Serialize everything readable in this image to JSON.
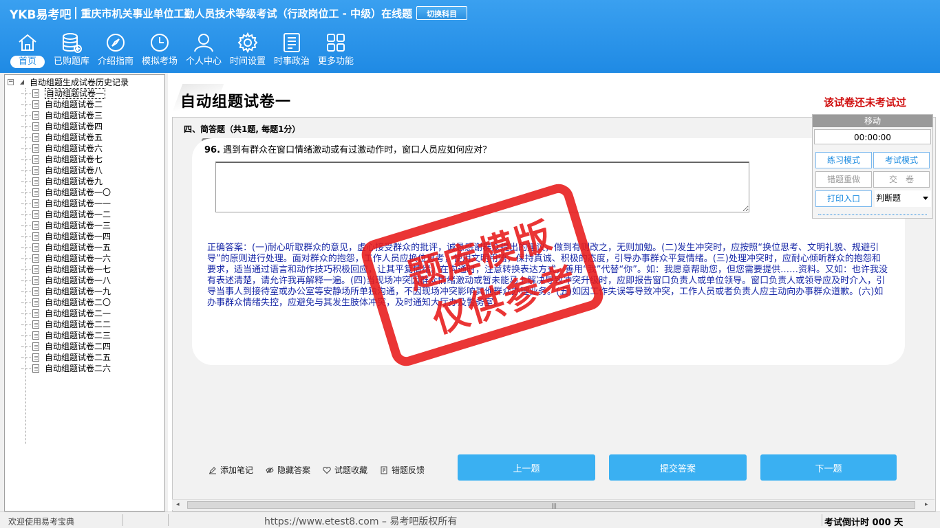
{
  "header": {
    "logo": "YKB易考吧",
    "app_title": "重庆市机关事业单位工勤人员技术等级考试（行政岗位工 - 中级）在线题",
    "switch_button": "切换科目",
    "nav": [
      {
        "label": "首页",
        "icon": "home-icon"
      },
      {
        "label": "已购题库",
        "icon": "database-icon"
      },
      {
        "label": "介绍指南",
        "icon": "compass-icon"
      },
      {
        "label": "模拟考场",
        "icon": "clock-icon"
      },
      {
        "label": "个人中心",
        "icon": "user-icon"
      },
      {
        "label": "时间设置",
        "icon": "gear-icon"
      },
      {
        "label": "时事政治",
        "icon": "news-icon"
      },
      {
        "label": "更多功能",
        "icon": "grid-icon"
      }
    ]
  },
  "tree": {
    "root": "自动组题生成试卷历史记录",
    "items": [
      "自动组题试卷一",
      "自动组题试卷二",
      "自动组题试卷三",
      "自动组题试卷四",
      "自动组题试卷五",
      "自动组题试卷六",
      "自动组题试卷七",
      "自动组题试卷八",
      "自动组题试卷九",
      "自动组题试卷一〇",
      "自动组题试卷一一",
      "自动组题试卷一二",
      "自动组题试卷一三",
      "自动组题试卷一四",
      "自动组题试卷一五",
      "自动组题试卷一六",
      "自动组题试卷一七",
      "自动组题试卷一八",
      "自动组题试卷一九",
      "自动组题试卷二〇",
      "自动组题试卷二一",
      "自动组题试卷二二",
      "自动组题试卷二三",
      "自动组题试卷二四",
      "自动组题试卷二五",
      "自动组题试卷二六"
    ]
  },
  "main": {
    "paper_title": "自动组题试卷一",
    "not_taken": "该试卷还未考试过",
    "section_title": "四、简答题（共1题, 每题1分）",
    "question_number": "96.",
    "question_text": "遇到有群众在窗口情绪激动或有过激动作时，窗口人员应如何应对？",
    "correct_answer": "正确答案：(一)耐心听取群众的意见，虚心接受群众的批评，诚恳感谢群众提出的建议，做到有则改之，无则加勉。(二)发生冲突时，应按照“换位思考、文明礼貌、规避引导”的原则进行处理。面对群众的抱怨，工作人员应换位思考，使用文明用语，保持真诚、积极的态度，引导办事群众平复情绪。(三)处理冲突时，应耐心倾听群众的抱怨和要求，适当通过语言和动作技巧积极回应，让其平复情绪。在沟通时，注意转换表达方式，善用“我”代替“你”。如：我愿意帮助您，但您需要提供……资料。又如：也许我没有表述清楚，请允许我再解释一遍。(四)当现场冲突因群众情绪激动或暂未能马上解决导致冲突升级时，应即报告窗口负责人或单位领导。窗口负责人或领导应及时介入，引导当事人到接待室或办公室等安静场所单独沟通，不因现场冲突影响其他群众办理业务。(五)如因工作失误等导致冲突，工作人员或者负责人应主动向办事群众道歉。(六)如办事群众情绪失控，应避免与其发生肢体冲突，及时通知大厅办及警务室。",
    "watermark_line1": "题库模版",
    "watermark_line2": "仅供参考",
    "tools": [
      "添加笔记",
      "隐藏答案",
      "试题收藏",
      "错题反馈"
    ],
    "prev_button": "上一题",
    "submit_button": "提交答案",
    "next_button": "下一题"
  },
  "rpanel": {
    "move": "移动",
    "timer": "00:00:00",
    "practice_mode": "练习模式",
    "exam_mode": "考试模式",
    "redo_wrong": "错题重做",
    "submit": "交　卷",
    "print": "打印入口",
    "question_type": "判断题"
  },
  "status": {
    "welcome": "欢迎使用易考宝典",
    "url": "https://www.etest8.com – 易考吧版权所有",
    "countdown": "考试倒计时 000 天"
  },
  "colors": {
    "header": "#1f8ae4",
    "button": "#3ab0f2",
    "answer": "#1a2aa8",
    "stamp": "#e81a1a",
    "warning": "#d01010"
  }
}
